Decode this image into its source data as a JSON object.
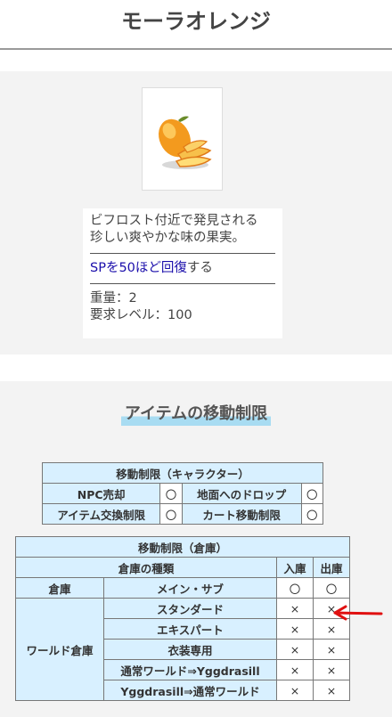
{
  "page": {
    "title": "モーラオレンジ"
  },
  "item": {
    "image_icon": "mango-orange-icon",
    "desc_line1": "ビフロスト付近で発見される",
    "desc_line2": "珍しい爽やかな味の果実。",
    "effect_link": "SPを50ほど回復",
    "effect_suffix": "する",
    "weight": "重量：2",
    "required_level": "要求レベル：100"
  },
  "section": {
    "title": "アイテムの移動制限"
  },
  "char_table": {
    "header": "移動制限（キャラクター）",
    "rows": [
      [
        "NPC売却",
        "〇",
        "地面へのドロップ",
        "〇"
      ],
      [
        "アイテム交換制限",
        "〇",
        "カート移動制限",
        "〇"
      ]
    ]
  },
  "storage_table": {
    "header": "移動制限（倉庫）",
    "col_type": "倉庫の種類",
    "col_in": "入庫",
    "col_out": "出庫",
    "group1": "倉庫",
    "group2": "ワールド倉庫",
    "rows": [
      {
        "name": "メイン・サブ",
        "in": "〇",
        "out": "〇"
      },
      {
        "name": "スタンダード",
        "in": "×",
        "out": "×"
      },
      {
        "name": "エキスパート",
        "in": "×",
        "out": "×"
      },
      {
        "name": "衣装専用",
        "in": "×",
        "out": "×"
      },
      {
        "name": "通常ワールド⇒Yggdrasill",
        "in": "×",
        "out": "×"
      },
      {
        "name": "Yggdrasill⇒通常ワールド",
        "in": "×",
        "out": "×"
      }
    ]
  },
  "annotation": {
    "arrow_color": "#e01010",
    "arrow_icon": "red-arrow-icon"
  }
}
